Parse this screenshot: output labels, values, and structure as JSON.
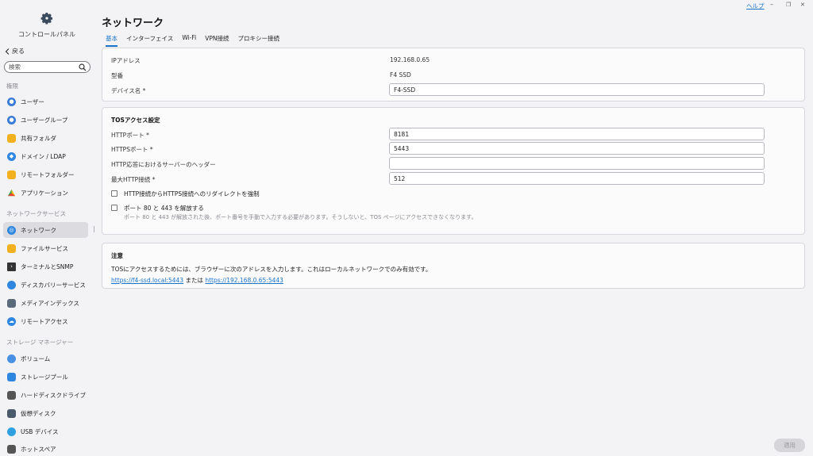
{
  "window": {
    "help_label": "ヘルプ",
    "minimize_glyph": "–",
    "restore_glyph": "❐",
    "close_glyph": "✕"
  },
  "sidebar": {
    "title": "コントロールパネル",
    "back_label": "戻る",
    "search_placeholder": "検索",
    "groups": [
      {
        "label": "権限"
      },
      {
        "label": "ネットワークサービス"
      },
      {
        "label": "ストレージ マネージャー"
      }
    ],
    "items": [
      {
        "label": "ユーザー",
        "icon": "user-icon",
        "color": "#3a7bd5"
      },
      {
        "label": "ユーザーグループ",
        "icon": "user-group-icon",
        "color": "#3a7bd5"
      },
      {
        "label": "共有フォルダ",
        "icon": "folder-icon",
        "color": "#f2b01e"
      },
      {
        "label": "ドメイン / LDAP",
        "icon": "domain-icon",
        "color": "#2f86e0"
      },
      {
        "label": "リモートフォルダー",
        "icon": "remote-folder-icon",
        "color": "#f2b01e"
      },
      {
        "label": "アプリケーション",
        "icon": "application-icon",
        "color": "#34a853"
      },
      {
        "label": "ネットワーク",
        "icon": "network-icon",
        "color": "#2f86e0"
      },
      {
        "label": "ファイルサービス",
        "icon": "file-service-icon",
        "color": "#f2b01e"
      },
      {
        "label": "ターミナルとSNMP",
        "icon": "terminal-icon",
        "color": "#333333"
      },
      {
        "label": "ディスカバリーサービス",
        "icon": "discovery-icon",
        "color": "#2f86e0"
      },
      {
        "label": "メディアインデックス",
        "icon": "media-index-icon",
        "color": "#5a6a7a"
      },
      {
        "label": "リモートアクセス",
        "icon": "cloud-icon",
        "color": "#2f86e0"
      },
      {
        "label": "ボリューム",
        "icon": "volume-icon",
        "color": "#4a90e2"
      },
      {
        "label": "ストレージプール",
        "icon": "storage-pool-icon",
        "color": "#2f86e0"
      },
      {
        "label": "ハードディスクドライブ",
        "icon": "hdd-icon",
        "color": "#555555"
      },
      {
        "label": "仮想ディスク",
        "icon": "virtual-disk-icon",
        "color": "#4a5a6a"
      },
      {
        "label": "USB デバイス",
        "icon": "usb-icon",
        "color": "#2fa0e0"
      },
      {
        "label": "ホットスペア",
        "icon": "hot-spare-icon",
        "color": "#555555"
      }
    ]
  },
  "main": {
    "title": "ネットワーク",
    "tabs": [
      {
        "label": "基本"
      },
      {
        "label": "インターフェイス"
      },
      {
        "label": "Wi-Fi"
      },
      {
        "label": "VPN接続"
      },
      {
        "label": "プロキシー接続"
      }
    ],
    "basic": {
      "ip_label": "IPアドレス",
      "ip_value": "192.168.0.65",
      "model_label": "型番",
      "model_value": "F4 SSD",
      "device_name_label": "デバイス名 *",
      "device_name_value": "F4-SSD"
    },
    "tos": {
      "title": "TOSアクセス設定",
      "http_port_label": "HTTPポート *",
      "http_port_value": "8181",
      "https_port_label": "HTTPSポート *",
      "https_port_value": "5443",
      "server_header_label": "HTTP応答におけるサーバーのヘッダー",
      "server_header_value": "",
      "max_http_label": "最大HTTP接続 *",
      "max_http_value": "512",
      "redirect_label": "HTTP接続からHTTPS接続へのリダイレクトを強制",
      "release_ports_label": "ポート 80 と 443 を解放する",
      "release_ports_hint": "ポート 80 と 443 が解放された後、ポート番号を手動で入力する必要があります。そうしないと、TOS ページにアクセスできなくなります。"
    },
    "note": {
      "title": "注意",
      "text": "TOSにアクセスするためには、ブラウザーに次のアドレスを入力します。これはローカルネットワークでのみ有効です。",
      "link1": "https://f4-ssd.local:5443",
      "separator": "または",
      "link2": "https://192.168.0.65:5443"
    },
    "apply_label": "適用"
  }
}
